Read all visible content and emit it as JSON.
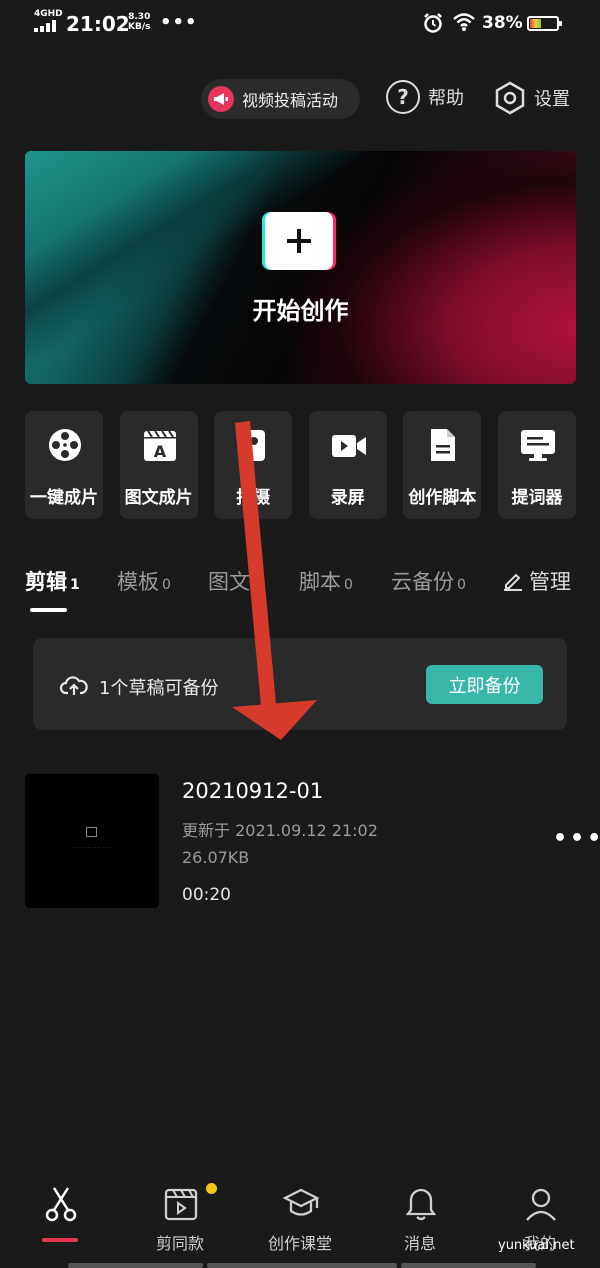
{
  "status_bar": {
    "network": "4GHD",
    "time": "21:02",
    "speed_value": "8.30",
    "speed_unit": "KB/s",
    "more": "•••",
    "battery_percent": "38%"
  },
  "header": {
    "promo_label": "视频投稿活动",
    "help_label": "帮助",
    "settings_label": "设置"
  },
  "hero": {
    "title": "开始创作"
  },
  "tools": [
    {
      "label": "一键成片",
      "icon": "film-reel-icon"
    },
    {
      "label": "图文成片",
      "icon": "text-clapper-icon"
    },
    {
      "label": "拍摄",
      "icon": "camera-icon"
    },
    {
      "label": "录屏",
      "icon": "video-record-icon"
    },
    {
      "label": "创作脚本",
      "icon": "script-doc-icon"
    },
    {
      "label": "提词器",
      "icon": "teleprompter-icon"
    }
  ],
  "tabs": [
    {
      "label": "剪辑",
      "count": "1"
    },
    {
      "label": "模板",
      "count": "0"
    },
    {
      "label": "图文",
      "count": ""
    },
    {
      "label": "脚本",
      "count": "0"
    },
    {
      "label": "云备份",
      "count": "0"
    }
  ],
  "manage_label": "管理",
  "backup": {
    "text": "1个草稿可备份",
    "button": "立即备份"
  },
  "draft": {
    "name": "20210912-01",
    "updated": "更新于 2021.09.12 21:02",
    "size": "26.07KB",
    "duration": "00:20",
    "more": "•••"
  },
  "nav": [
    {
      "label": "",
      "icon": "scissors-icon",
      "active": true
    },
    {
      "label": "剪同款",
      "icon": "template-clapper-icon"
    },
    {
      "label": "创作课堂",
      "icon": "graduation-cap-icon"
    },
    {
      "label": "消息",
      "icon": "bell-icon"
    },
    {
      "label": "我的",
      "icon": "profile-icon"
    }
  ],
  "watermark": "yunkuai.net",
  "colors": {
    "background": "#1a1a1a",
    "card": "#2a2a2a",
    "accent_teal": "#38b7a9",
    "accent_red": "#e6334f",
    "arrow_red": "#d63a2a",
    "badge_yellow": "#f5c518"
  }
}
